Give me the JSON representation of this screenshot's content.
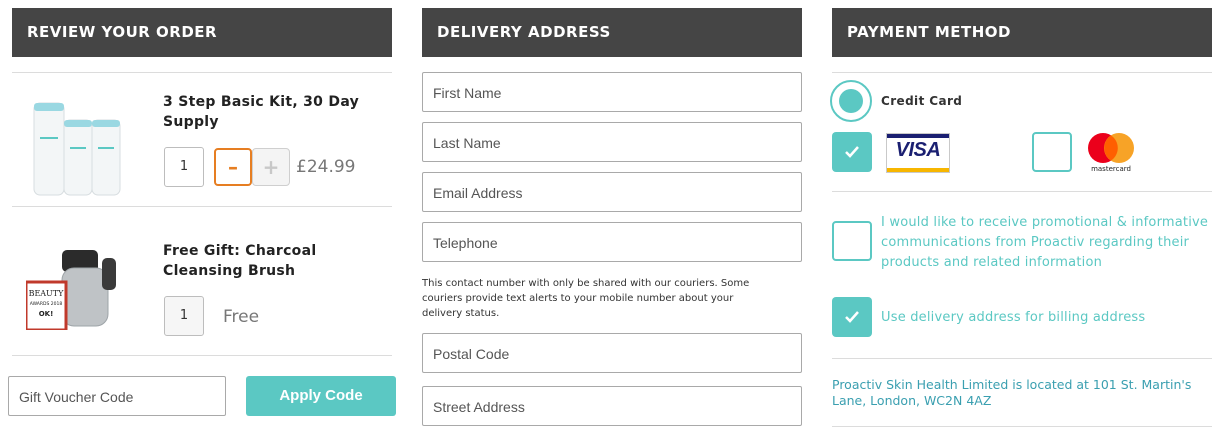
{
  "review": {
    "header": "REVIEW YOUR ORDER",
    "items": [
      {
        "title_line1": "3 Step Basic Kit, 30 Day",
        "title_line2": "Supply",
        "qty": "1",
        "minus": "–",
        "plus": "+",
        "price": "£24.99"
      },
      {
        "title_line1": "Free Gift: Charcoal",
        "title_line2": "Cleansing Brush",
        "qty": "1",
        "price": "Free",
        "badge_line1": "BEAUTY",
        "badge_line2": "AWARDS 2018",
        "badge_line3": "OK!"
      }
    ],
    "voucher_placeholder": "Gift Voucher Code",
    "apply_label": "Apply Code"
  },
  "delivery": {
    "header": "DELIVERY ADDRESS",
    "first_name": "First Name",
    "last_name": "Last Name",
    "email": "Email Address",
    "telephone": "Telephone",
    "note_line1": "This contact number with only be shared with our couriers. Some",
    "note_line2": "couriers provide text alerts to your mobile number about your",
    "note_line3": "delivery status.",
    "postal_code": "Postal Code",
    "street_address": "Street Address"
  },
  "payment": {
    "header": "PAYMENT METHOD",
    "credit_card_label": "Credit Card",
    "visa_text": "VISA",
    "mastercard_text": "mastercard",
    "promo_line1": "I would like to receive promotional & informative",
    "promo_line2": "communications from Proactiv regarding their",
    "promo_line3": "products and related information",
    "billing_label": "Use delivery address for billing address",
    "company_line1": "Proactiv Skin Health Limited is located at 101 St. Martin's",
    "company_line2": "Lane, London, WC2N 4AZ"
  },
  "colors": {
    "header_bg": "#454545",
    "accent": "#5bc8c3",
    "stepper_active": "#e67e22"
  }
}
